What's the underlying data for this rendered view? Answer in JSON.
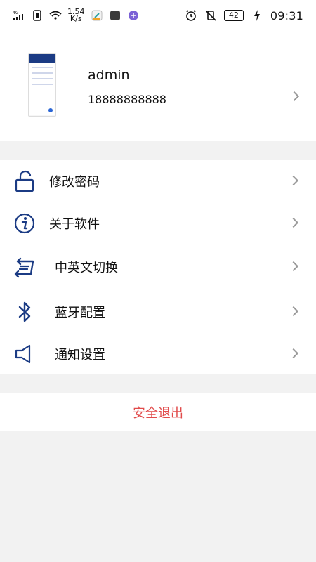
{
  "status_bar": {
    "network": "4G",
    "speed_value": "1.54",
    "speed_unit": "K/s",
    "battery": "42",
    "time": "09:31"
  },
  "profile": {
    "name": "admin",
    "phone": "18888888888"
  },
  "menu": {
    "items": [
      {
        "label": "修改密码",
        "icon": "lock-icon"
      },
      {
        "label": "关于软件",
        "icon": "info-icon"
      },
      {
        "label": "中英文切换",
        "icon": "swap-icon"
      },
      {
        "label": "蓝牙配置",
        "icon": "bluetooth-icon"
      },
      {
        "label": "通知设置",
        "icon": "speaker-icon"
      }
    ]
  },
  "logout_label": "安全退出",
  "colors": {
    "accent_dark": "#1b3b84",
    "danger": "#e14b4b",
    "background": "#f2f2f2"
  }
}
